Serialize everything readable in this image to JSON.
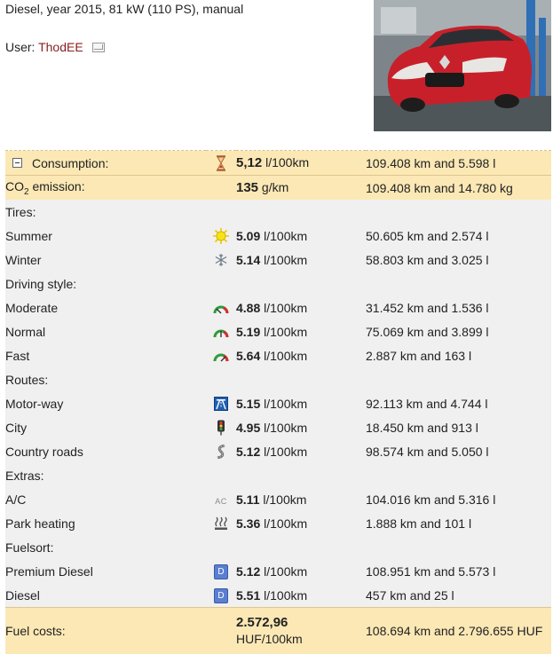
{
  "header": {
    "specs": "Diesel, year 2015, 81 kW (110 PS), manual",
    "user_label": "User:",
    "user_name": "ThodEE"
  },
  "summary": {
    "consumption": {
      "label": "Consumption:",
      "value": "5,12",
      "unit": "l/100km",
      "distance": "109.408 km and 5.598 l",
      "icon": "hourglass-icon"
    },
    "co2": {
      "label_main": "CO",
      "label_sub": "2",
      "label_rest": " emission:",
      "value": "135",
      "unit": "g/km",
      "distance": "109.408 km and 14.780 kg"
    }
  },
  "groups": [
    {
      "title": "Tires:",
      "rows": [
        {
          "label": "Summer",
          "value": "5.09",
          "unit": "l/100km",
          "distance": "50.605 km and 2.574 l",
          "icon": "sun-icon"
        },
        {
          "label": "Winter",
          "value": "5.14",
          "unit": "l/100km",
          "distance": "58.803 km and 3.025 l",
          "icon": "snowflake-icon"
        }
      ]
    },
    {
      "title": "Driving style:",
      "rows": [
        {
          "label": "Moderate",
          "value": "4.88",
          "unit": "l/100km",
          "distance": "31.452 km and 1.536 l",
          "icon": "gauge-low-icon"
        },
        {
          "label": "Normal",
          "value": "5.19",
          "unit": "l/100km",
          "distance": "75.069 km and 3.899 l",
          "icon": "gauge-mid-icon"
        },
        {
          "label": "Fast",
          "value": "5.64",
          "unit": "l/100km",
          "distance": "2.887 km and 163 l",
          "icon": "gauge-high-icon"
        }
      ]
    },
    {
      "title": "Routes:",
      "rows": [
        {
          "label": "Motor-way",
          "value": "5.15",
          "unit": "l/100km",
          "distance": "92.113 km and 4.744 l",
          "icon": "motorway-icon"
        },
        {
          "label": "City",
          "value": "4.95",
          "unit": "l/100km",
          "distance": "18.450 km and 913 l",
          "icon": "traffic-light-icon"
        },
        {
          "label": "Country roads",
          "value": "5.12",
          "unit": "l/100km",
          "distance": "98.574 km and 5.050 l",
          "icon": "winding-road-icon"
        }
      ]
    },
    {
      "title": "Extras:",
      "rows": [
        {
          "label": "A/C",
          "value": "5.11",
          "unit": "l/100km",
          "distance": "104.016 km and 5.316 l",
          "icon": "ac-icon",
          "icon_text": "AC"
        },
        {
          "label": "Park heating",
          "value": "5.36",
          "unit": "l/100km",
          "distance": "1.888 km and 101 l",
          "icon": "heating-icon"
        }
      ]
    },
    {
      "title": "Fuelsort:",
      "rows": [
        {
          "label": "Premium Diesel",
          "value": "5.12",
          "unit": "l/100km",
          "distance": "108.951 km and 5.573 l",
          "icon": "diesel-icon",
          "icon_text": "D"
        },
        {
          "label": "Diesel",
          "value": "5.51",
          "unit": "l/100km",
          "distance": "457 km and 25 l",
          "icon": "diesel-icon",
          "icon_text": "D"
        }
      ]
    }
  ],
  "fuel_costs": {
    "label": "Fuel costs:",
    "value": "2.572,96",
    "unit": "HUF/100km",
    "distance": "108.694 km and 2.796.655 HUF"
  }
}
